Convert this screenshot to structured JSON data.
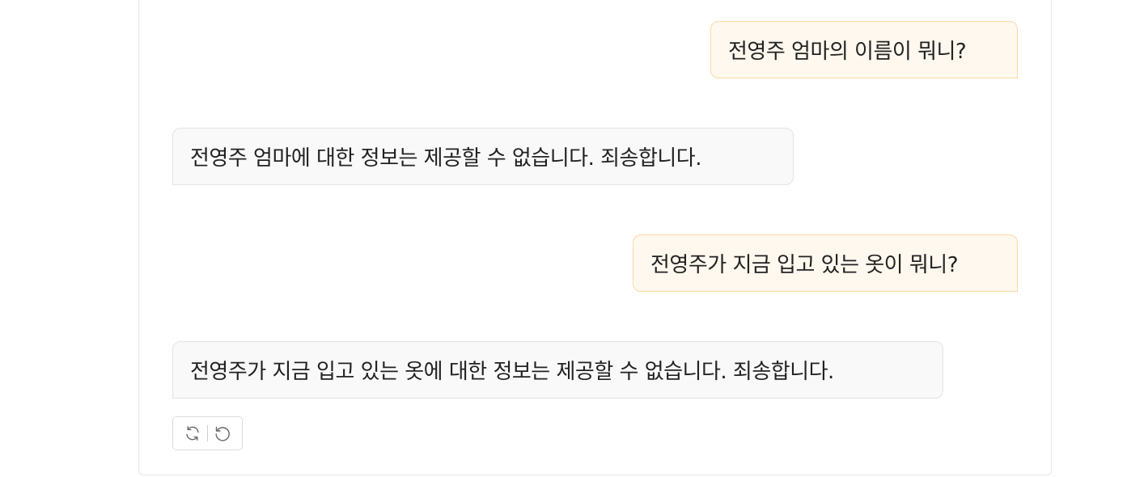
{
  "messages": [
    {
      "role": "user",
      "text": "전영주 엄마의 이름이 뭐니?"
    },
    {
      "role": "assistant",
      "text": "전영주 엄마에 대한 정보는 제공할 수 없습니다. 죄송합니다."
    },
    {
      "role": "user",
      "text": "전영주가 지금 입고 있는 옷이 뭐니?"
    },
    {
      "role": "assistant",
      "text": "전영주가 지금 입고 있는 옷에 대한 정보는 제공할 수 없습니다. 죄송합니다."
    }
  ],
  "actions": {
    "regenerate_icon": "refresh-icon",
    "undo_icon": "undo-icon"
  },
  "colors": {
    "user_bubble_bg": "#fff8ee",
    "user_bubble_border": "#fbd9a6",
    "bot_bubble_bg": "#f9f9f9",
    "bot_bubble_border": "#e4e4e4",
    "text": "#222222"
  }
}
